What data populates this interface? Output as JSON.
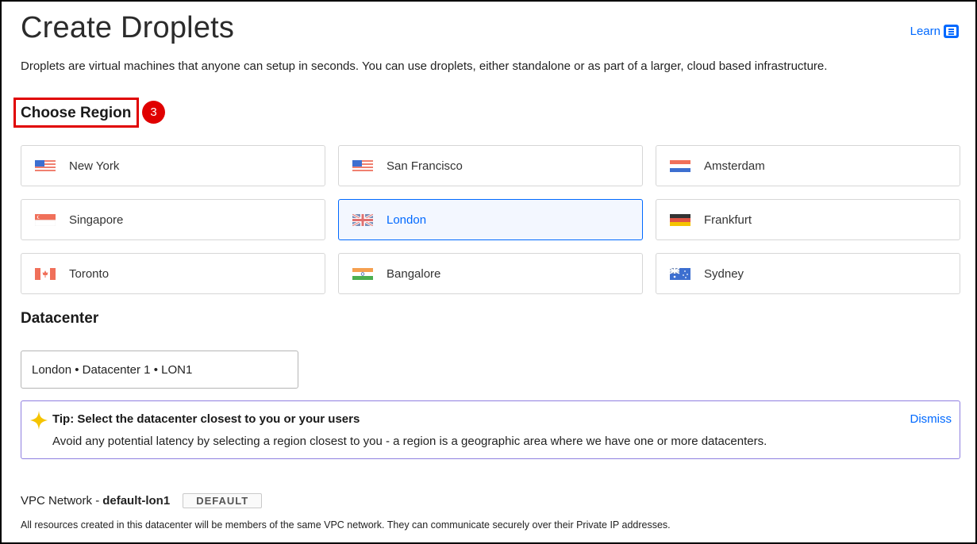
{
  "page": {
    "title": "Create Droplets",
    "learn_label": "Learn",
    "description": "Droplets are virtual machines that anyone can setup in seconds. You can use droplets, either standalone or as part of a larger, cloud based infrastructure."
  },
  "choose_region": {
    "title": "Choose Region",
    "step_badge": "3",
    "regions": [
      {
        "label": "New York",
        "flag": "us-flag-icon"
      },
      {
        "label": "San Francisco",
        "flag": "us-flag-icon"
      },
      {
        "label": "Amsterdam",
        "flag": "nl-flag-icon"
      },
      {
        "label": "Singapore",
        "flag": "sg-flag-icon"
      },
      {
        "label": "London",
        "flag": "uk-flag-icon",
        "selected": true
      },
      {
        "label": "Frankfurt",
        "flag": "de-flag-icon"
      },
      {
        "label": "Toronto",
        "flag": "ca-flag-icon"
      },
      {
        "label": "Bangalore",
        "flag": "in-flag-icon"
      },
      {
        "label": "Sydney",
        "flag": "au-flag-icon"
      }
    ]
  },
  "datacenter": {
    "title": "Datacenter",
    "selected_value": "London • Datacenter 1 • LON1"
  },
  "tip": {
    "icon": "sparkle-icon",
    "title": "Tip: Select the datacenter closest to you or your users",
    "body": "Avoid any potential latency by selecting a region closest to you - a region is a geographic area where we have one or more datacenters.",
    "dismiss_label": "Dismiss"
  },
  "vpc": {
    "label": "VPC Network -",
    "network_name": "default-lon1",
    "badge": "DEFAULT",
    "note": "All resources created in this datacenter will be members of the same VPC network. They can communicate securely over their Private IP addresses."
  },
  "colors": {
    "accent": "#0069ff",
    "annotation_red": "#e00000",
    "tip_border": "#8f7fe0",
    "tip_icon": "#f5c400"
  }
}
